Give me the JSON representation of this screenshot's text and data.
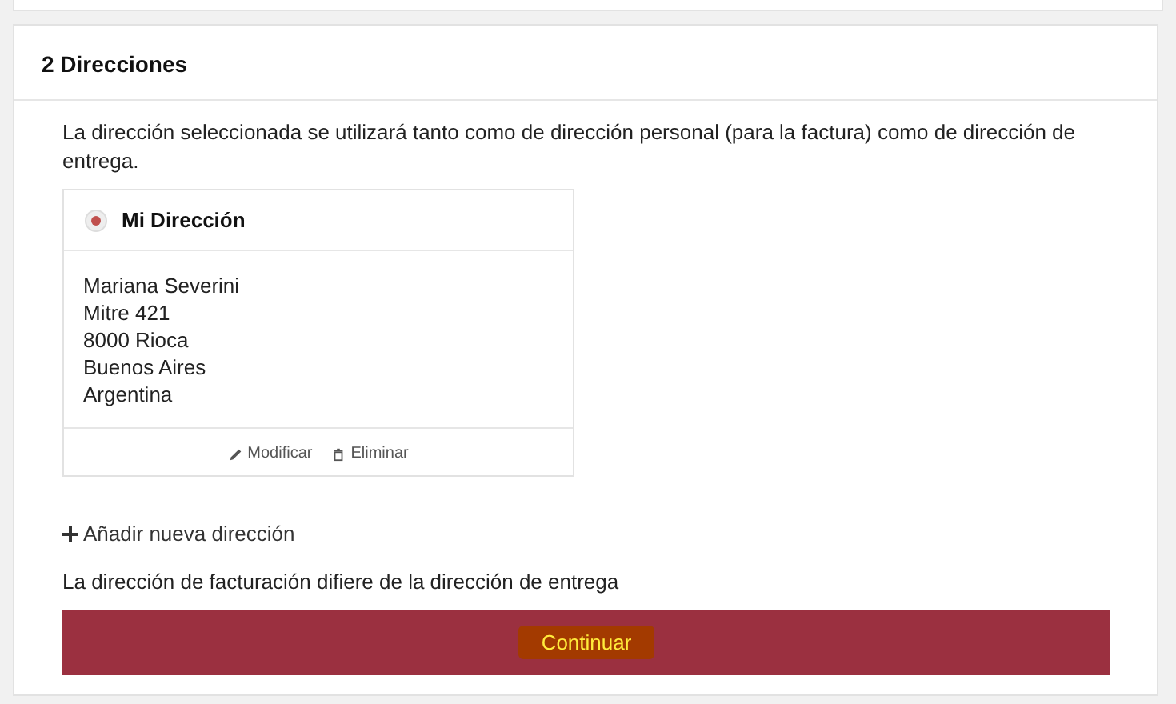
{
  "section": {
    "title": "2 Direcciones",
    "intro": "La dirección seleccionada se utilizará tanto como de dirección personal (para la factura) como de dirección de entrega.",
    "addresses": [
      {
        "title": "Mi Dirección",
        "selected": true,
        "lines": [
          "Mariana Severini",
          "Mitre 421",
          "8000 Rioca",
          "Buenos Aires",
          "Argentina"
        ],
        "actions": [
          {
            "kind": "edit",
            "label": "Modificar"
          },
          {
            "kind": "delete",
            "label": "Eliminar"
          }
        ]
      }
    ],
    "add_link": "Añadir nueva dirección",
    "billing_note": "La dirección de facturación difiere de la dirección de entrega",
    "continue_button": "Continuar"
  }
}
